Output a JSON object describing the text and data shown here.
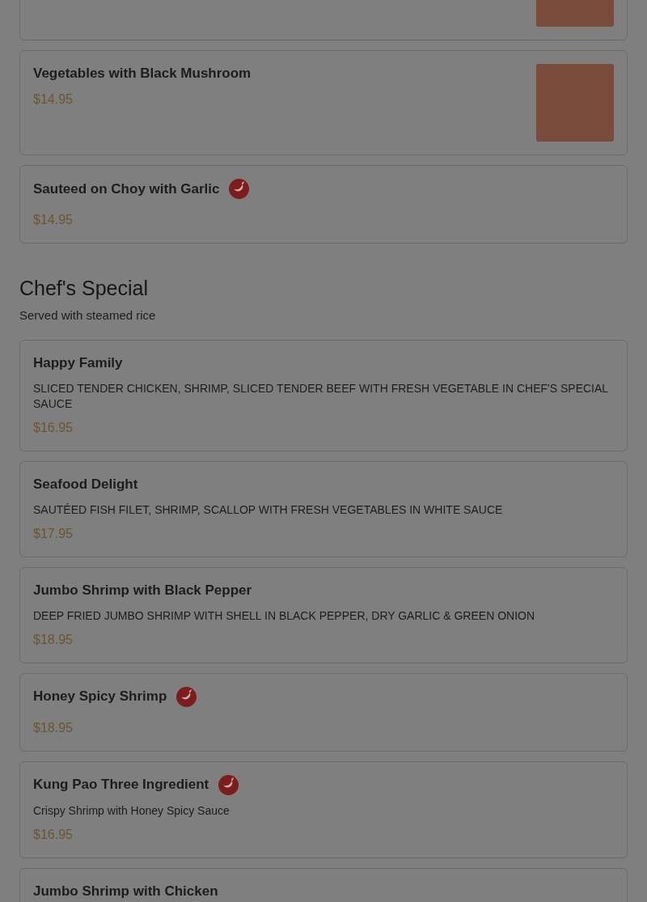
{
  "sections": [
    {
      "items": [
        {
          "photo": true,
          "spicy": false
        },
        {
          "name": "Vegetables with Black Mushroom",
          "price": "$14.95",
          "photo": true,
          "spicy": false
        },
        {
          "name": "Sauteed on Choy with Garlic",
          "price": "$14.95",
          "photo": false,
          "spicy": true
        }
      ]
    },
    {
      "title": "Chef's Special",
      "subtitle": "Served with steamed rice",
      "items": [
        {
          "name": "Happy Family",
          "description": "SLICED TENDER CHICKEN, SHRIMP, SLICED TENDER BEEF WITH FRESH VEGETABLE IN CHEF'S SPECIAL SAUCE",
          "price": "$16.95",
          "photo": false,
          "spicy": false
        },
        {
          "name": "Seafood Delight",
          "description": "SAUTÉED FISH FILET, SHRIMP, SCALLOP WITH FRESH VEGETABLES IN WHITE SAUCE",
          "price": "$17.95",
          "photo": false,
          "spicy": false
        },
        {
          "name": "Jumbo Shrimp with Black Pepper",
          "description": "DEEP FRIED JUMBO SHRIMP WITH SHELL IN BLACK PEPPER, DRY GARLIC & GREEN ONION",
          "price": "$18.95",
          "photo": false,
          "spicy": false
        },
        {
          "name": "Honey Spicy Shrimp",
          "price": "$18.95",
          "photo": false,
          "spicy": true
        },
        {
          "name": "Kung Pao Three Ingredient",
          "description": "Crispy Shrimp with Honey Spicy Sauce",
          "price": "$16.95",
          "photo": false,
          "spicy": true
        },
        {
          "name": "Jumbo Shrimp with Chicken",
          "photo": false,
          "spicy": false
        }
      ]
    }
  ]
}
